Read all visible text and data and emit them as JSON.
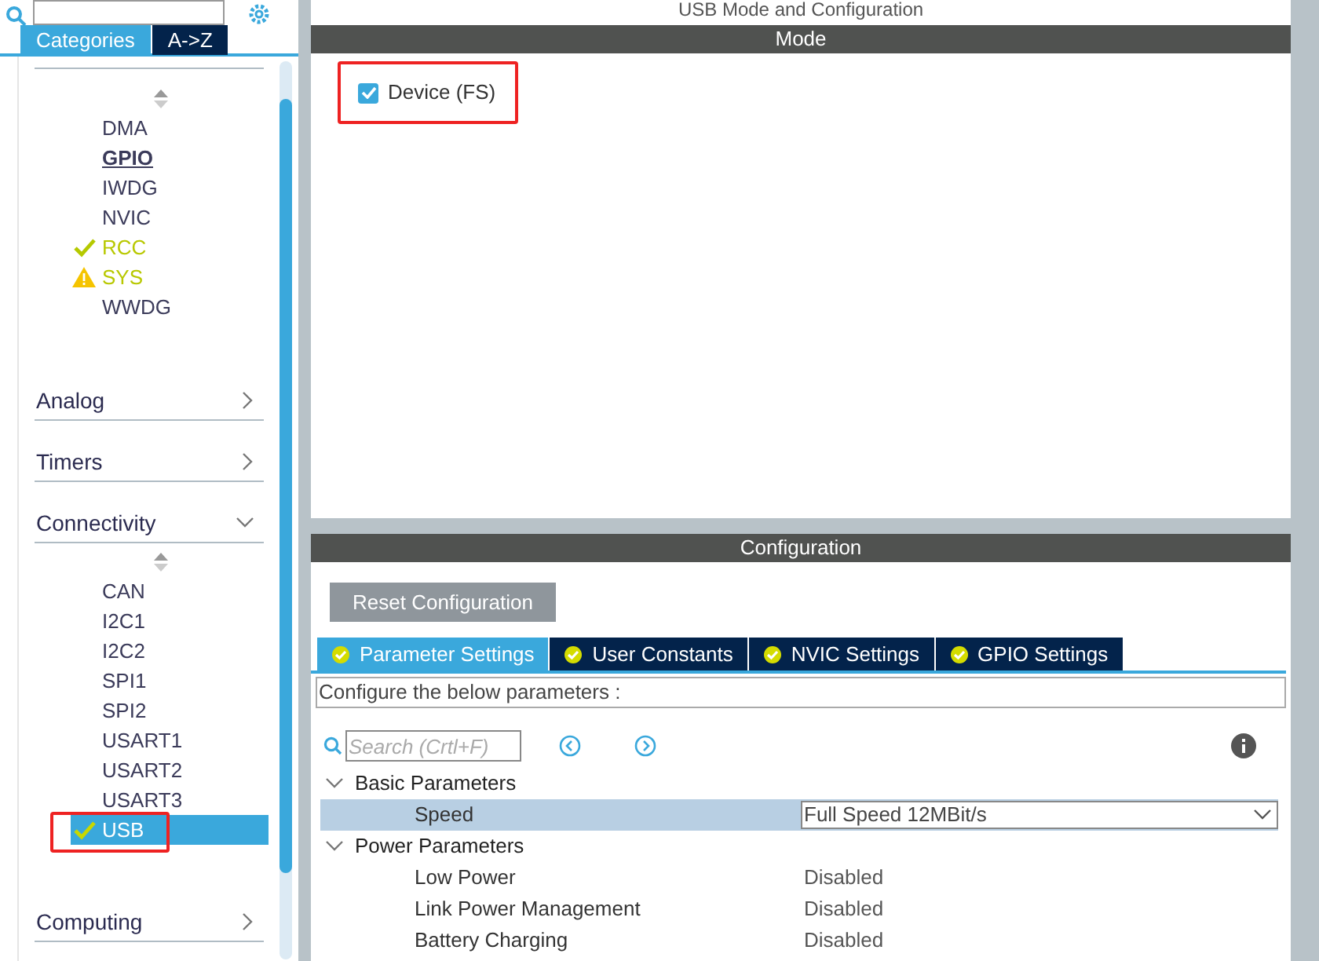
{
  "sidebar": {
    "tabs": [
      {
        "label": "Categories",
        "selected": true
      },
      {
        "label": "A->Z",
        "selected": false
      }
    ],
    "top_items": [
      {
        "label": "DMA",
        "kind": "plain",
        "configured": false,
        "selected": false,
        "highlighted": false
      },
      {
        "label": "GPIO",
        "kind": "plain",
        "configured": true,
        "selected": false,
        "highlighted": false
      },
      {
        "label": "IWDG",
        "kind": "plain",
        "configured": false,
        "selected": false,
        "highlighted": false
      },
      {
        "label": "NVIC",
        "kind": "plain",
        "configured": false,
        "selected": false,
        "highlighted": false
      },
      {
        "label": "RCC",
        "kind": "ok",
        "configured": false,
        "selected": false,
        "highlighted": false
      },
      {
        "label": "SYS",
        "kind": "warning",
        "configured": false,
        "selected": false,
        "highlighted": false
      },
      {
        "label": "WWDG",
        "kind": "plain",
        "configured": false,
        "selected": false,
        "highlighted": false
      }
    ],
    "categories": [
      {
        "label": "Analog",
        "expanded": false
      },
      {
        "label": "Timers",
        "expanded": false
      },
      {
        "label": "Connectivity",
        "expanded": true,
        "items": [
          {
            "label": "CAN",
            "kind": "plain",
            "configured": false,
            "selected": false,
            "highlighted": false
          },
          {
            "label": "I2C1",
            "kind": "plain",
            "configured": false,
            "selected": false,
            "highlighted": false
          },
          {
            "label": "I2C2",
            "kind": "plain",
            "configured": false,
            "selected": false,
            "highlighted": false
          },
          {
            "label": "SPI1",
            "kind": "plain",
            "configured": false,
            "selected": false,
            "highlighted": false
          },
          {
            "label": "SPI2",
            "kind": "plain",
            "configured": false,
            "selected": false,
            "highlighted": false
          },
          {
            "label": "USART1",
            "kind": "plain",
            "configured": false,
            "selected": false,
            "highlighted": false
          },
          {
            "label": "USART2",
            "kind": "plain",
            "configured": false,
            "selected": false,
            "highlighted": false
          },
          {
            "label": "USART3",
            "kind": "plain",
            "configured": false,
            "selected": false,
            "highlighted": false
          },
          {
            "label": "USB",
            "kind": "ok",
            "configured": false,
            "selected": true,
            "highlighted": true
          }
        ]
      },
      {
        "label": "Computing",
        "expanded": false
      }
    ]
  },
  "main": {
    "title": "USB Mode and Configuration",
    "mode_header": "Mode",
    "mode": {
      "label": "Device (FS)",
      "checked": true,
      "highlighted": true
    },
    "config_header": "Configuration",
    "reset_button": "Reset Configuration",
    "tabs": [
      {
        "label": "Parameter Settings",
        "selected": true
      },
      {
        "label": "User Constants",
        "selected": false
      },
      {
        "label": "NVIC Settings",
        "selected": false
      },
      {
        "label": "GPIO Settings",
        "selected": false
      }
    ],
    "description": "Configure the below parameters :",
    "search": {
      "placeholder": "Search (Crtl+F)"
    },
    "groups": [
      {
        "label": "Basic Parameters",
        "expanded": true,
        "params": [
          {
            "name": "Speed",
            "value": "Full Speed 12MBit/s",
            "kind": "dropdown",
            "selected": true
          }
        ]
      },
      {
        "label": "Power Parameters",
        "expanded": true,
        "params": [
          {
            "name": "Low Power",
            "value": "Disabled",
            "kind": "text",
            "selected": false
          },
          {
            "name": "Link Power Management",
            "value": "Disabled",
            "kind": "text",
            "selected": false
          },
          {
            "name": "Battery Charging",
            "value": "Disabled",
            "kind": "text",
            "selected": false
          }
        ]
      }
    ]
  }
}
